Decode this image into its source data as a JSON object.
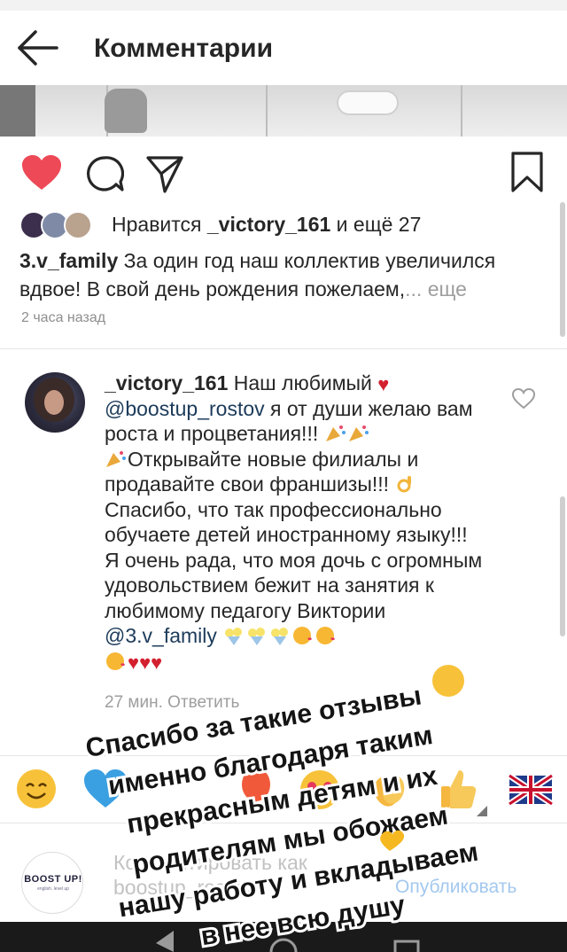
{
  "header": {
    "title": "Комментарии"
  },
  "post": {
    "likes": {
      "prefix": "Нравится ",
      "user": "_victory_161",
      "suffix": " и ещё 27"
    },
    "caption": {
      "author": "3.v_family",
      "text": " За один год наш коллектив увеличился вдвое! В свой день рождения пожелаем,",
      "more": "... еще"
    },
    "time_ago": "2 часа назад"
  },
  "comment": {
    "author": "_victory_161",
    "part1": " Наш любимый ",
    "mention1": "@boostup_rostov",
    "part2": " я от души желаю вам роста и процветания!!! ",
    "part3": "Открывайте новые филиалы и продавайте свои франшизы!!! ",
    "part4": " Спасибо, что так профессионально обучаете детей иностранному языку!!! ",
    "part5": "Я очень рада, что моя дочь с огромным удовольствием бежит на занятия к любимому педагогу Виктории ",
    "mention2": "@3.v_family",
    "meta": "27 мин.    Ответить"
  },
  "input": {
    "placeholder": "Комментировать как boostup_rostov...",
    "publish": "Опубликовать",
    "brand_name": "BOOST UP!",
    "brand_sub": "english. level up"
  },
  "overlay_lines": [
    "Спасибо за такие отзывы",
    "именно благодаря таким",
    "прекрасным детям и их",
    "родителям мы обожаем",
    "нашу работу и вкладываем",
    "в нее всю душу"
  ],
  "colors": {
    "like_red": "#ed4956",
    "mention_blue": "#1c3b5a",
    "publish_blue": "#a3c8ef",
    "overlay_text": "#141414"
  },
  "icons": [
    "back-arrow-icon",
    "heart-icon",
    "comment-icon",
    "share-icon",
    "bookmark-icon",
    "like-outline-icon"
  ]
}
